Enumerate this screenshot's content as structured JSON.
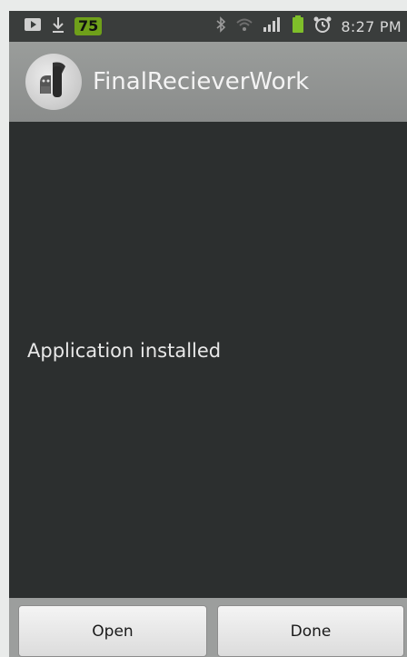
{
  "status_bar": {
    "notification_badge": "75",
    "time": "8:27 PM",
    "icons": [
      "media-icon",
      "download-icon",
      "bluetooth-icon",
      "wifi-icon",
      "signal-icon",
      "battery-icon",
      "alarm-icon"
    ]
  },
  "title_bar": {
    "app_name": "FinalRecieverWork",
    "icon": "android-app-icon"
  },
  "content": {
    "message": "Application installed"
  },
  "buttons": {
    "open_label": "Open",
    "done_label": "Done"
  },
  "colors": {
    "status_bar_bg": "#3a3d3c",
    "title_bar_bg": "#8e908f",
    "content_bg": "#2c2f2f",
    "badge_bg": "#6fa01a"
  }
}
